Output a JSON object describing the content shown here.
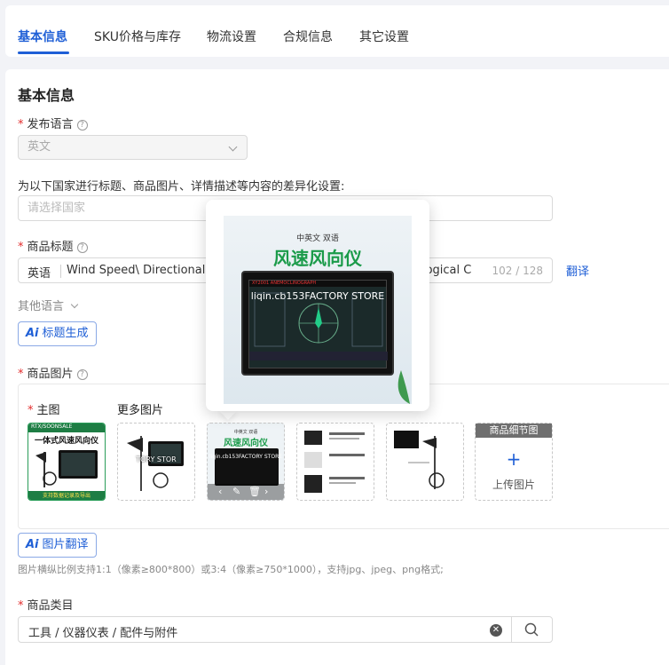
{
  "tabs": [
    {
      "label": "基本信息",
      "active": true
    },
    {
      "label": "SKU价格与库存"
    },
    {
      "label": "物流设置"
    },
    {
      "label": "合规信息"
    },
    {
      "label": "其它设置"
    }
  ],
  "section_title": "基本信息",
  "publish_language": {
    "label": "发布语言",
    "value": "英文"
  },
  "countries": {
    "label": "为以下国家进行标题、商品图片、详情描述等内容的差异化设置:",
    "placeholder": "请选择国家"
  },
  "product_title": {
    "label": "商品标题",
    "lang": "英语",
    "value_left": "Wind Speed\\ Directional Inte",
    "value_right": "eorological C",
    "count": "102 / 128",
    "translate": "翻译"
  },
  "other_languages": "其他语言",
  "ai_title_button": "标题生成",
  "ai_badge": "Ai",
  "product_images": {
    "label": "商品图片",
    "main_label": "主图",
    "more_label": "更多图片",
    "thumb1_title": "一体式风速风向仪",
    "thumb1_brand": "RTX/SOONSALE",
    "thumb1_footer": "支持数据记录及导出",
    "thumb2_wm": "TORY STOR",
    "thumb3_sub": "中英文 双语",
    "thumb3_title": "风速风向仪",
    "thumb3_wm": "liqin.cb153FACTORY STORE",
    "upload_tag": "商品细节图",
    "upload_text": "上传图片",
    "translate_button": "图片翻译",
    "hint": "图片横纵比例支持1:1（像素≥800*800）或3:4（像素≥750*1000），支持jpg、jpeg、png格式;"
  },
  "popover": {
    "sub": "中英文 双语",
    "title": "风速风向仪",
    "device_head": "XY2001  ANEMOCLINOGRAPH",
    "watermark": "liqin.cb153FACTORY STORE"
  },
  "category": {
    "label": "商品类目",
    "value": "工具 / 仪器仪表 / 配件与附件"
  },
  "colors": {
    "accent": "#1f5fd6",
    "required": "#e22c2c",
    "green": "#1b9b4a"
  }
}
